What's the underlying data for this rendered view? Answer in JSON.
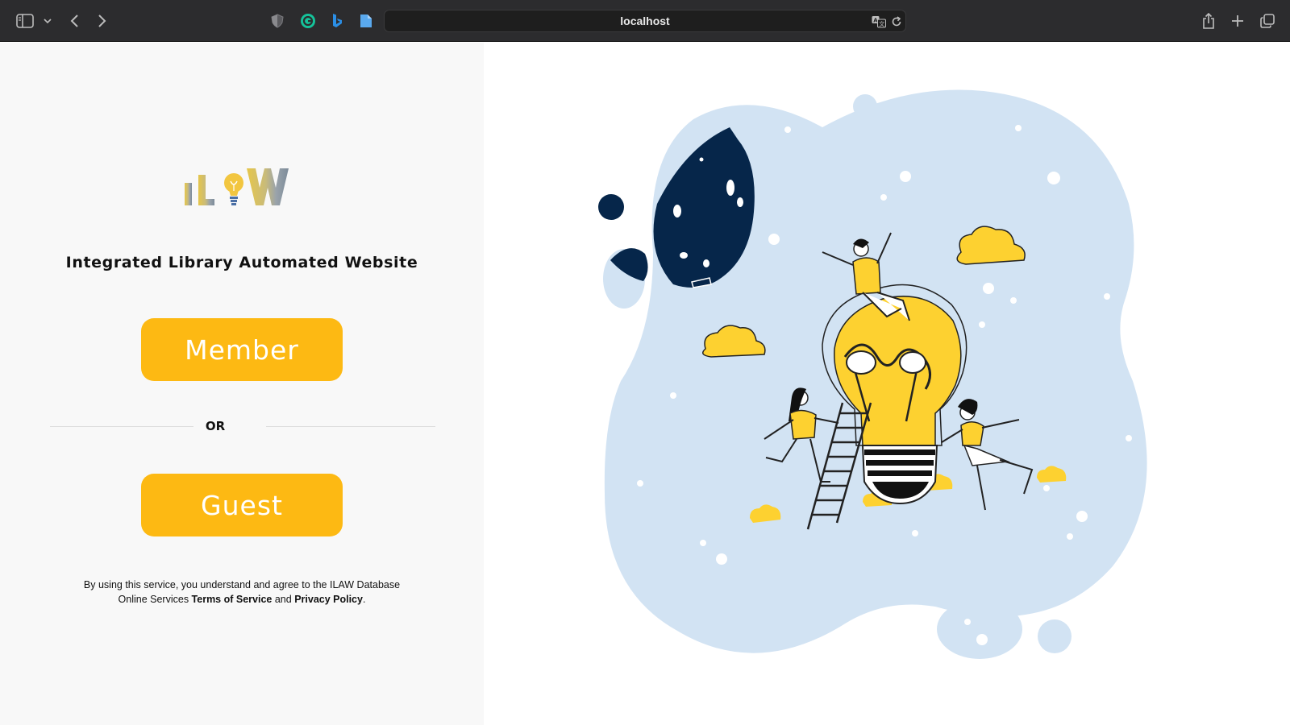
{
  "browser": {
    "url": "localhost",
    "icons": [
      "sidebar-icon",
      "chevron-down-icon",
      "back-icon",
      "forward-icon",
      "shield-icon",
      "grammarly-icon",
      "bing-icon",
      "notes-icon",
      "translate-icon",
      "reload-icon",
      "share-icon",
      "new-tab-icon",
      "tabs-overview-icon"
    ]
  },
  "login": {
    "logo_text": "ILAW",
    "title": "Integrated Library Automated Website",
    "member_label": "Member",
    "or_label": "OR",
    "guest_label": "Guest",
    "legal": {
      "prefix": "By using this service, you understand and agree to the ILAW Database Online Services ",
      "terms": "Terms of Service",
      "and": " and ",
      "privacy": "Privacy Policy",
      "suffix": "."
    }
  },
  "colors": {
    "accent": "#fdb913",
    "blob": "#d2e3f3",
    "navy": "#06264a",
    "bulb_yellow": "#fdd130"
  }
}
